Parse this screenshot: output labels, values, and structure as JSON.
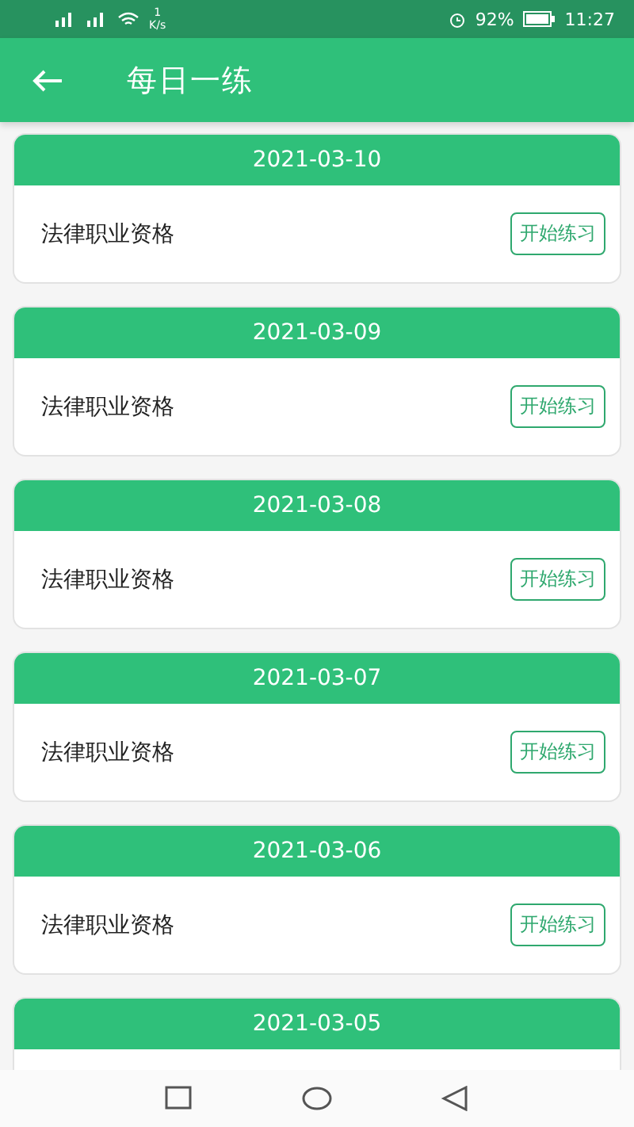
{
  "status_bar": {
    "speed_value": "1",
    "speed_unit": "K/s",
    "battery": "92%",
    "time": "11:27"
  },
  "app_bar": {
    "title": "每日一练"
  },
  "cards": [
    {
      "date": "2021-03-10",
      "subject": "法律职业资格",
      "button": "开始练习"
    },
    {
      "date": "2021-03-09",
      "subject": "法律职业资格",
      "button": "开始练习"
    },
    {
      "date": "2021-03-08",
      "subject": "法律职业资格",
      "button": "开始练习"
    },
    {
      "date": "2021-03-07",
      "subject": "法律职业资格",
      "button": "开始练习"
    },
    {
      "date": "2021-03-06",
      "subject": "法律职业资格",
      "button": "开始练习"
    },
    {
      "date": "2021-03-05"
    }
  ]
}
